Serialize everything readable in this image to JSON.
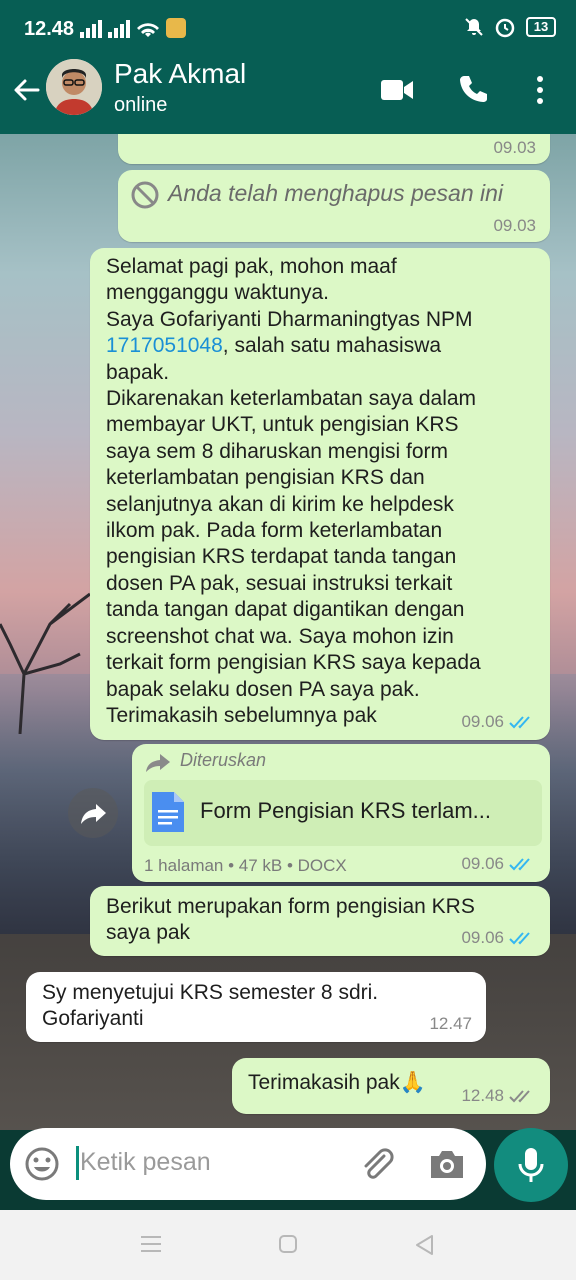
{
  "status": {
    "time": "12.48",
    "battery": "13"
  },
  "header": {
    "contact_name": "Pak Akmal",
    "presence": "online"
  },
  "messages": {
    "top_time": "09.03",
    "deleted": {
      "text": "Anda telah menghapus pesan ini",
      "time": "09.03"
    },
    "long": {
      "part1": "Selamat pagi pak, mohon maaf\nmengganggu waktunya.\nSaya Gofariyanti Dharmaningtyas NPM\n",
      "npm": "1717051048",
      "part2": ", salah satu mahasiswa\nbapak.\nDikarenakan keterlambatan saya dalam\nmembayar UKT, untuk pengisian KRS\nsaya sem 8 diharuskan mengisi form\nketerlambatan pengisian  KRS dan\nselanjutnya akan di kirim ke helpdesk\nilkom pak. Pada form keterlambatan\npengisian KRS terdapat tanda tangan\ndosen PA pak, sesuai instruksi terkait\ntanda tangan dapat digantikan dengan\nscreenshot chat wa. Saya mohon izin\nterkait form pengisian KRS saya kepada\nbapak selaku dosen PA saya pak.\nTerimakasih sebelumnya pak",
      "time": "09.06"
    },
    "forwarded": {
      "label": "Diteruskan",
      "file_name": "Form Pengisian KRS terlam...",
      "file_info": "1 halaman • 47 kB • DOCX",
      "time": "09.06"
    },
    "followup": {
      "text": "Berikut merupakan form pengisian KRS\nsaya pak",
      "time": "09.06"
    },
    "reply": {
      "text": "Sy menyetujui KRS semester 8 sdri.\nGofariyanti",
      "time": "12.47"
    },
    "thanks": {
      "text": "Terimakasih pak",
      "emoji": "🙏",
      "time": "12.48"
    }
  },
  "input": {
    "placeholder": "Ketik pesan"
  },
  "colors": {
    "header": "#075e54",
    "outgoing": "#dcf8c6",
    "incoming": "#ffffff",
    "tick_read": "#34b7f1",
    "mic": "#128c7e"
  }
}
